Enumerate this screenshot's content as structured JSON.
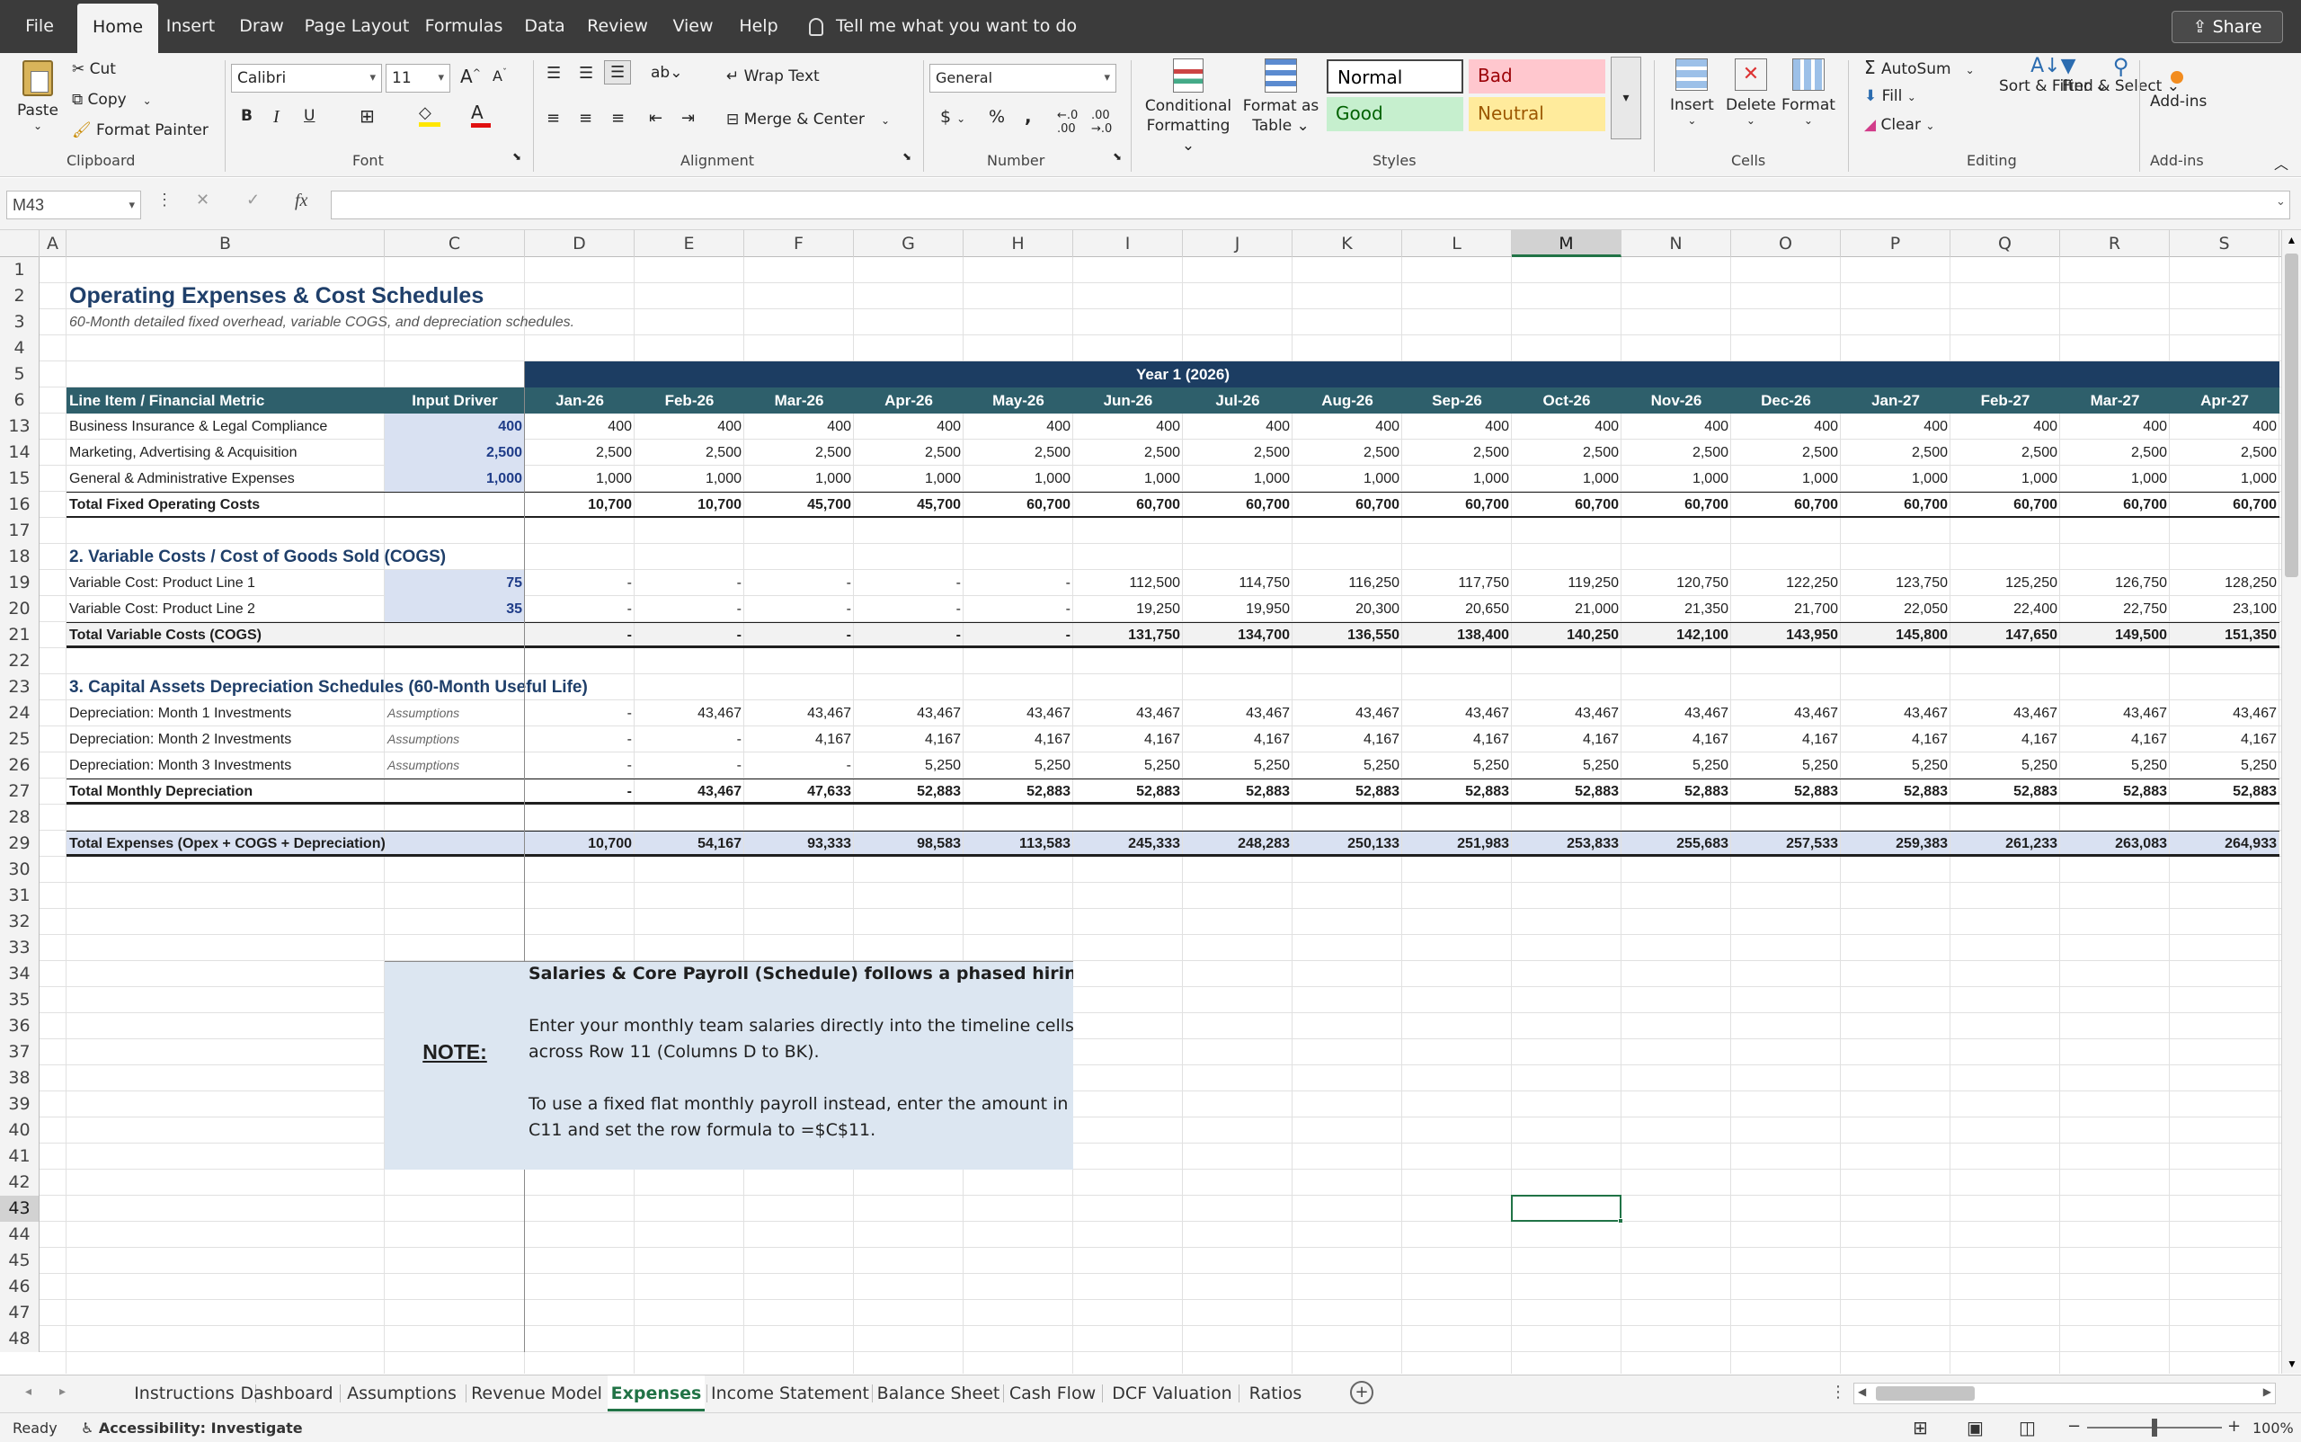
{
  "menu": {
    "tabs": [
      "File",
      "Home",
      "Insert",
      "Draw",
      "Page Layout",
      "Formulas",
      "Data",
      "Review",
      "View",
      "Help"
    ],
    "active_tab": "Home",
    "tell_me": "Tell me what you want to do",
    "share": "Share"
  },
  "ribbon": {
    "clipboard": {
      "paste": "Paste",
      "cut": "Cut",
      "copy": "Copy",
      "format_painter": "Format Painter",
      "label": "Clipboard"
    },
    "font": {
      "name": "Calibri",
      "size": "11",
      "label": "Font"
    },
    "alignment": {
      "wrap": "Wrap Text",
      "merge": "Merge & Center",
      "label": "Alignment"
    },
    "number": {
      "format": "General",
      "label": "Number"
    },
    "styles": {
      "conditional": "Conditional Formatting",
      "format_table": "Format as Table",
      "normal": "Normal",
      "bad": "Bad",
      "good": "Good",
      "neutral": "Neutral",
      "label": "Styles"
    },
    "cells": {
      "insert": "Insert",
      "delete": "Delete",
      "format": "Format",
      "label": "Cells"
    },
    "editing": {
      "autosum": "AutoSum",
      "fill": "Fill",
      "clear": "Clear",
      "sort": "Sort & Filter",
      "find": "Find & Select",
      "label": "Editing"
    },
    "addins": {
      "addins": "Add-ins",
      "label": "Add-ins"
    }
  },
  "formula_bar": {
    "name_box": "M43",
    "fx": "fx",
    "value": ""
  },
  "columns": [
    "A",
    "B",
    "C",
    "D",
    "E",
    "F",
    "G",
    "H",
    "I",
    "J",
    "K",
    "L",
    "M",
    "N",
    "O",
    "P",
    "Q",
    "R",
    "S"
  ],
  "active_cell": "M43",
  "rows": [
    "1",
    "2",
    "3",
    "4",
    "5",
    "6",
    "13",
    "14",
    "15",
    "16",
    "17",
    "18",
    "19",
    "20",
    "21",
    "22",
    "23",
    "24",
    "25",
    "26",
    "27",
    "28",
    "29",
    "30",
    "31",
    "32",
    "33",
    "34",
    "35",
    "36",
    "37",
    "38",
    "39",
    "40",
    "41",
    "42",
    "43",
    "44",
    "45",
    "46",
    "47",
    "48"
  ],
  "sheet": {
    "title": "Operating Expenses & Cost Schedules",
    "subtitle": "60-Month detailed fixed overhead, variable COGS, and depreciation schedules.",
    "year_band": "Year 1 (2026)",
    "header": {
      "item": "Line Item / Financial Metric",
      "driver": "Input Driver",
      "months": [
        "Jan-26",
        "Feb-26",
        "Mar-26",
        "Apr-26",
        "May-26",
        "Jun-26",
        "Jul-26",
        "Aug-26",
        "Sep-26",
        "Oct-26",
        "Nov-26",
        "Dec-26",
        "Jan-27",
        "Feb-27",
        "Mar-27",
        "Apr-27"
      ]
    },
    "fixed_rows": [
      {
        "label": "Business Insurance & Legal Compliance",
        "driver": "400",
        "values": [
          "400",
          "400",
          "400",
          "400",
          "400",
          "400",
          "400",
          "400",
          "400",
          "400",
          "400",
          "400",
          "400",
          "400",
          "400",
          "400"
        ]
      },
      {
        "label": "Marketing, Advertising & Acquisition",
        "driver": "2,500",
        "values": [
          "2,500",
          "2,500",
          "2,500",
          "2,500",
          "2,500",
          "2,500",
          "2,500",
          "2,500",
          "2,500",
          "2,500",
          "2,500",
          "2,500",
          "2,500",
          "2,500",
          "2,500",
          "2,500"
        ]
      },
      {
        "label": "General & Administrative Expenses",
        "driver": "1,000",
        "values": [
          "1,000",
          "1,000",
          "1,000",
          "1,000",
          "1,000",
          "1,000",
          "1,000",
          "1,000",
          "1,000",
          "1,000",
          "1,000",
          "1,000",
          "1,000",
          "1,000",
          "1,000",
          "1,000"
        ]
      }
    ],
    "fixed_total": {
      "label": "Total Fixed Operating Costs",
      "values": [
        "10,700",
        "10,700",
        "45,700",
        "45,700",
        "60,700",
        "60,700",
        "60,700",
        "60,700",
        "60,700",
        "60,700",
        "60,700",
        "60,700",
        "60,700",
        "60,700",
        "60,700",
        "60,700"
      ]
    },
    "section2": "2. Variable Costs / Cost of Goods Sold (COGS)",
    "var_rows": [
      {
        "label": "Variable Cost: Product Line 1",
        "driver": "75",
        "values": [
          "-",
          "-",
          "-",
          "-",
          "-",
          "112,500",
          "114,750",
          "116,250",
          "117,750",
          "119,250",
          "120,750",
          "122,250",
          "123,750",
          "125,250",
          "126,750",
          "128,250"
        ]
      },
      {
        "label": "Variable Cost: Product Line 2",
        "driver": "35",
        "values": [
          "-",
          "-",
          "-",
          "-",
          "-",
          "19,250",
          "19,950",
          "20,300",
          "20,650",
          "21,000",
          "21,350",
          "21,700",
          "22,050",
          "22,400",
          "22,750",
          "23,100"
        ]
      }
    ],
    "var_total": {
      "label": "Total Variable Costs (COGS)",
      "values": [
        "-",
        "-",
        "-",
        "-",
        "-",
        "131,750",
        "134,700",
        "136,550",
        "138,400",
        "140,250",
        "142,100",
        "143,950",
        "145,800",
        "147,650",
        "149,500",
        "151,350"
      ]
    },
    "section3": "3. Capital Assets Depreciation Schedules (60-Month Useful Life)",
    "dep_rows": [
      {
        "label": "Depreciation: Month 1 Investments",
        "driver": "Assumptions",
        "values": [
          "-",
          "43,467",
          "43,467",
          "43,467",
          "43,467",
          "43,467",
          "43,467",
          "43,467",
          "43,467",
          "43,467",
          "43,467",
          "43,467",
          "43,467",
          "43,467",
          "43,467",
          "43,467"
        ]
      },
      {
        "label": "Depreciation: Month 2 Investments",
        "driver": "Assumptions",
        "values": [
          "-",
          "-",
          "4,167",
          "4,167",
          "4,167",
          "4,167",
          "4,167",
          "4,167",
          "4,167",
          "4,167",
          "4,167",
          "4,167",
          "4,167",
          "4,167",
          "4,167",
          "4,167"
        ]
      },
      {
        "label": "Depreciation: Month 3 Investments",
        "driver": "Assumptions",
        "values": [
          "-",
          "-",
          "-",
          "5,250",
          "5,250",
          "5,250",
          "5,250",
          "5,250",
          "5,250",
          "5,250",
          "5,250",
          "5,250",
          "5,250",
          "5,250",
          "5,250",
          "5,250"
        ]
      }
    ],
    "dep_total": {
      "label": "Total Monthly Depreciation",
      "values": [
        "-",
        "43,467",
        "47,633",
        "52,883",
        "52,883",
        "52,883",
        "52,883",
        "52,883",
        "52,883",
        "52,883",
        "52,883",
        "52,883",
        "52,883",
        "52,883",
        "52,883",
        "52,883"
      ]
    },
    "grand_total": {
      "label": "Total Expenses (Opex + COGS + Depreciation)",
      "values": [
        "10,700",
        "54,167",
        "93,333",
        "98,583",
        "113,583",
        "245,333",
        "248,283",
        "250,133",
        "251,983",
        "253,833",
        "255,683",
        "257,533",
        "259,383",
        "261,233",
        "263,083",
        "264,933"
      ]
    },
    "note": {
      "label": "NOTE:",
      "line1": "Salaries & Core Payroll (Schedule) follows a phased hiring plan.",
      "line2": "Enter your monthly team salaries directly into the timeline cells",
      "line3": "across Row 11 (Columns D to BK).",
      "line4": "To use a fixed flat monthly payroll instead, enter the amount in",
      "line5": "C11 and set the row formula to =$C$11."
    }
  },
  "sheet_tabs": [
    "Instructions",
    "Dashboard",
    "Assumptions",
    "Revenue Model",
    "Expenses",
    "Income Statement",
    "Balance Sheet",
    "Cash Flow",
    "DCF Valuation",
    "Ratios"
  ],
  "active_sheet": "Expenses",
  "status": {
    "ready": "Ready",
    "accessibility": "Accessibility: Investigate",
    "zoom": "100%"
  },
  "colors": {
    "header_teal": "#2e5f6b",
    "navy": "#1c3d62",
    "input_blue": "#d9e1f2",
    "accent_green": "#217346"
  }
}
